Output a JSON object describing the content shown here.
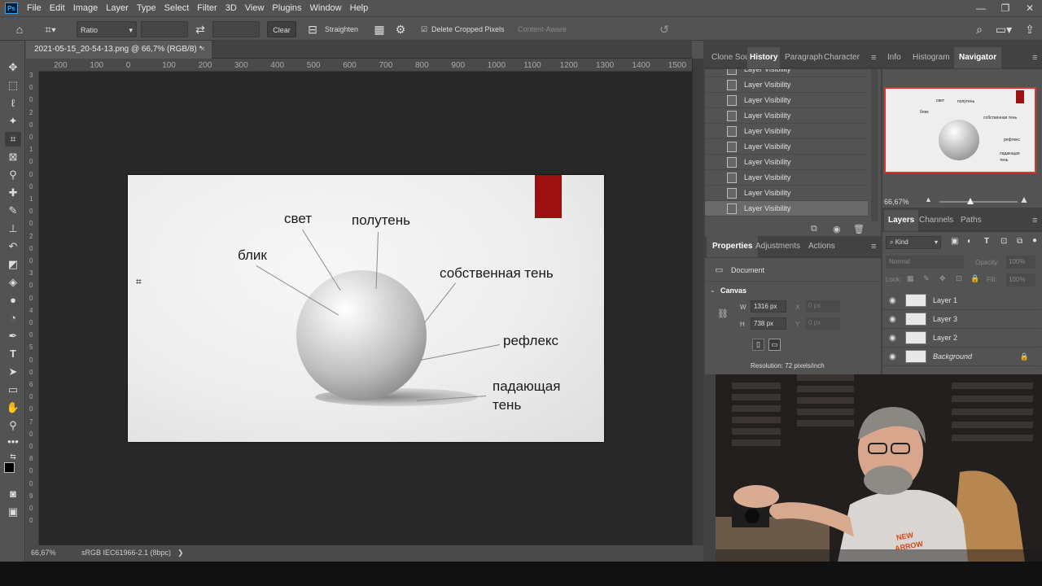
{
  "app": {
    "logo_text": "Ps",
    "menu": [
      "File",
      "Edit",
      "Image",
      "Layer",
      "Type",
      "Select",
      "Filter",
      "3D",
      "View",
      "Plugins",
      "Window",
      "Help"
    ],
    "window_controls": [
      "—",
      "❐",
      "✕"
    ]
  },
  "options_bar": {
    "ratio_select": "Ratio",
    "clear_label": "Clear",
    "straighten_label": "Straighten",
    "delete_cropped_label": "Delete Cropped Pixels",
    "content_aware_label": "Content-Aware",
    "delete_cropped_checked": true
  },
  "document": {
    "tab_title": "2021-05-15_20-54-13.png @ 66,7% (RGB/8) *",
    "tab_close": "×",
    "ruler_top": [
      "200",
      "100",
      "0",
      "100",
      "200",
      "300",
      "400",
      "500",
      "600",
      "700",
      "800",
      "900",
      "1000",
      "1100",
      "1200",
      "1300",
      "1400",
      "1500"
    ],
    "ruler_left": [
      "3",
      "0",
      "0",
      "2",
      "0",
      "0",
      "1",
      "0",
      "0",
      "0",
      "1",
      "0",
      "0",
      "2",
      "0",
      "0",
      "3",
      "0",
      "0",
      "4",
      "0",
      "0",
      "5",
      "0",
      "0",
      "6",
      "0",
      "0",
      "7",
      "0",
      "0",
      "8",
      "0",
      "0",
      "9",
      "0",
      "0"
    ],
    "zoom": "66,67%",
    "color_profile": "sRGB IEC61966-2.1 (8bpc)",
    "status_arrow": "❯"
  },
  "image": {
    "labels": {
      "light": "свет",
      "halftone": "полутень",
      "highlight": "блик",
      "own_shadow": "собственная тень",
      "reflex": "рефлекс",
      "cast_shadow_line1": "падающая",
      "cast_shadow_line2": "тень"
    },
    "swatch_color": "#9c1010"
  },
  "history_panel": {
    "tabs": [
      "Clone Sou",
      "History",
      "Paragraph",
      "Character"
    ],
    "active_tab": "History",
    "items": [
      "Layer Visibility",
      "Layer Visibility",
      "Layer Visibility",
      "Layer Visibility",
      "Layer Visibility",
      "Layer Visibility",
      "Layer Visibility",
      "Layer Visibility",
      "Layer Visibility",
      "Layer Visibility"
    ]
  },
  "navigator_panel": {
    "tabs": [
      "Info",
      "Histogram",
      "Navigator"
    ],
    "active_tab": "Navigator",
    "zoom": "66,67%",
    "thumb_labels": [
      "свет",
      "полутень",
      "блик",
      "собственная тень",
      "рефлекс",
      "падающая",
      "тень"
    ]
  },
  "properties_panel": {
    "tabs": [
      "Properties",
      "Adjustments",
      "Actions"
    ],
    "active_tab": "Properties",
    "doc_label": "Document",
    "canvas_section": "Canvas",
    "w_label": "W",
    "w_value": "1316 px",
    "h_label": "H",
    "h_value": "738 px",
    "x_label": "X",
    "x_value": "0 px",
    "y_label": "Y",
    "y_value": "0 px",
    "resolution": "Resolution: 72 pixels/inch"
  },
  "layers_panel": {
    "tabs": [
      "Layers",
      "Channels",
      "Paths"
    ],
    "active_tab": "Layers",
    "filter_kind": "Kind",
    "blend_mode": "Normal",
    "opacity_label": "Opacity:",
    "opacity_value": "100%",
    "lock_label": "Lock:",
    "fill_label": "Fill:",
    "fill_value": "100%",
    "layers": [
      {
        "name": "Layer 1",
        "visible": true
      },
      {
        "name": "Layer 3",
        "visible": true
      },
      {
        "name": "Layer 2",
        "visible": true
      },
      {
        "name": "Background",
        "visible": true,
        "locked": true
      }
    ]
  },
  "webcam": {
    "shirt_text_line1": "NEW",
    "shirt_text_line2": "ARROW"
  }
}
